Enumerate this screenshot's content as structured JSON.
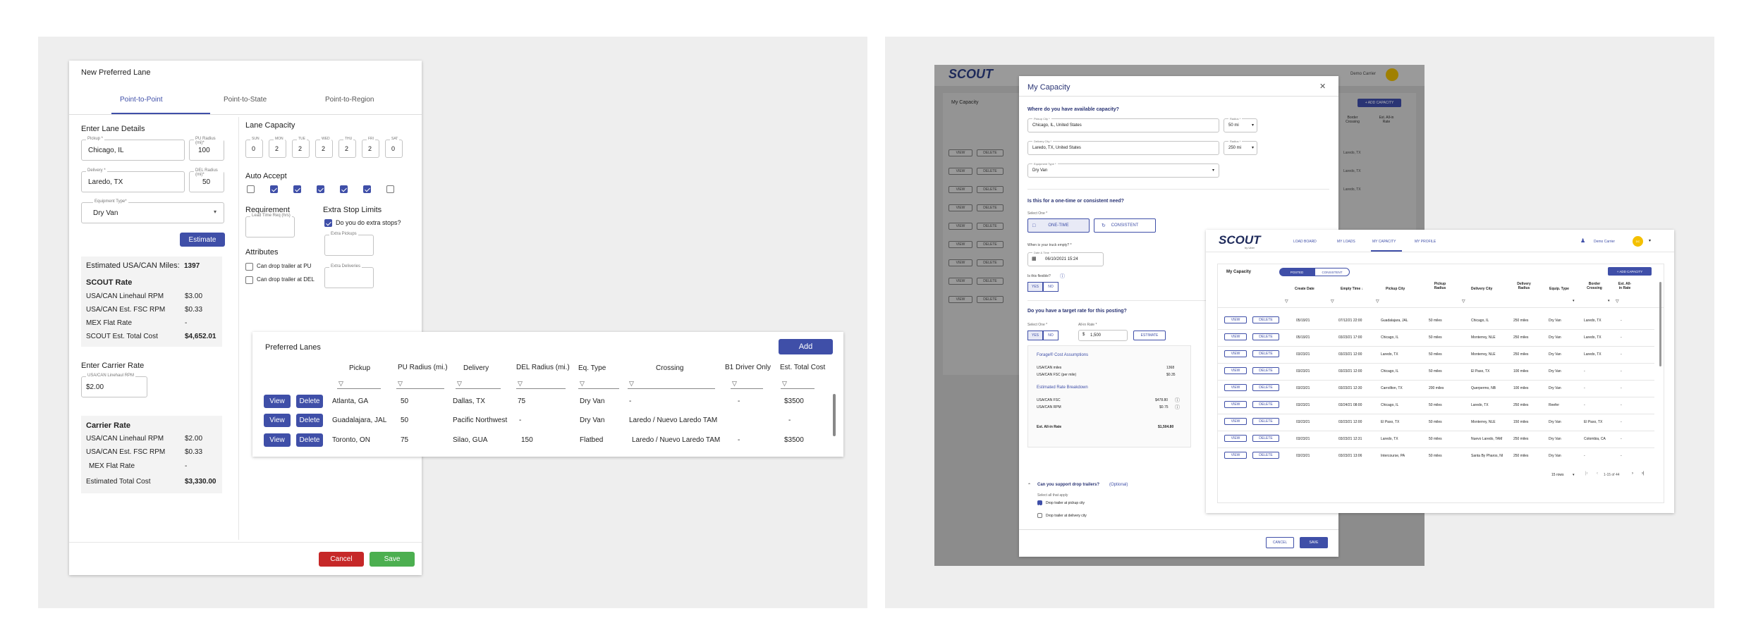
{
  "left": {
    "title": "New Preferred Lane",
    "tabs": [
      "Point-to-Point",
      "Point-to-State",
      "Point-to-Region"
    ],
    "enter_lane_details": "Enter Lane Details",
    "pickup_label": "Pickup *",
    "pickup_value": "Chicago, IL",
    "pu_radius_label": "PU Radius (mi)*",
    "pu_radius_value": "100",
    "delivery_label": "Delivery *",
    "delivery_value": "Laredo, TX",
    "del_radius_label": "DEL Radius (mi)*",
    "del_radius_value": "50",
    "equipment_label": "Equipment Type*",
    "equipment_value": "Dry Van",
    "estimate_btn": "Estimate",
    "lane_capacity": "Lane Capacity",
    "days": [
      {
        "label": "SUN",
        "value": "0",
        "auto": false
      },
      {
        "label": "MON",
        "value": "2",
        "auto": true
      },
      {
        "label": "TUE",
        "value": "2",
        "auto": true
      },
      {
        "label": "WED",
        "value": "2",
        "auto": true
      },
      {
        "label": "THU",
        "value": "2",
        "auto": true
      },
      {
        "label": "FRI",
        "value": "2",
        "auto": true
      },
      {
        "label": "SAT",
        "value": "0",
        "auto": false
      }
    ],
    "auto_accept": "Auto Accept",
    "requirement": "Requirement",
    "lead_time_label": "Lead Time Req (hrs)",
    "extra_stop_limits": "Extra Stop Limits",
    "extra_stops_q": "Do you do extra stops?",
    "extra_pickups_label": "Extra Pickups",
    "extra_deliveries_label": "Extra Deliveries",
    "attributes": "Attributes",
    "attr_pu": "Can drop trailer at PU",
    "attr_del": "Can drop trailer at DEL",
    "est_miles_label": "Estimated USA/CAN Miles:",
    "est_miles_value": "1397",
    "scout_rate": "SCOUT Rate",
    "scout_rows": [
      {
        "label": "USA/CAN Linehaul RPM",
        "value": "$3.00"
      },
      {
        "label": "USA/CAN Est. FSC RPM",
        "value": "$0.33"
      },
      {
        "label": "MEX Flat Rate",
        "value": "-"
      },
      {
        "label": "SCOUT Est. Total Cost",
        "value": "$4,652.01"
      }
    ],
    "enter_carrier_rate": "Enter Carrier Rate",
    "carrier_rpm_label": "USA/CAN Linehaul RPM",
    "carrier_rpm_value": "$2.00",
    "carrier_rate": "Carrier Rate",
    "carrier_rows": [
      {
        "label": "USA/CAN Linehaul RPM",
        "value": "$2.00"
      },
      {
        "label": "USA/CAN Est. FSC RPM",
        "value": "$0.33"
      },
      {
        "label": "MEX Flat Rate",
        "value": "-"
      },
      {
        "label": "Estimated Total Cost",
        "value": "$3,330.00"
      }
    ],
    "cancel_btn": "Cancel",
    "save_btn": "Save",
    "lanes": {
      "title": "Preferred Lanes",
      "add_btn": "Add",
      "headers": [
        "Pickup",
        "PU Radius (mi.)",
        "Delivery",
        "DEL Radius (mi.)",
        "Eq. Type",
        "Crossing",
        "B1 Driver Only",
        "Est. Total Cost"
      ],
      "view_btn": "View",
      "delete_btn": "Delete",
      "rows": [
        [
          "Atlanta, GA",
          "50",
          "Dallas, TX",
          "75",
          "Dry Van",
          "-",
          "-",
          "$3500"
        ],
        [
          "Guadalajara, JAL",
          "50",
          "Pacific Northwest",
          "-",
          "Dry Van",
          "Laredo / Nuevo Laredo TAM",
          "",
          "-"
        ],
        [
          "Toronto, ON",
          "75",
          "Silao, GUA",
          "150",
          "Flatbed",
          "Laredo / Nuevo Laredo TAM",
          "-",
          "$3500"
        ]
      ]
    }
  },
  "right": {
    "brand": "SCOUT",
    "brand_sub": "by Uber",
    "nav": [
      "LOAD BOARD",
      "MY LOADS",
      "MY CAPACITY",
      "MY PROFILE"
    ],
    "user": "Demo Carrier",
    "user_initials": "DC",
    "bg_my_capacity": "My Capacity",
    "bg_add": "+ ADD CAPACITY",
    "bg_headers": [
      "Border Crossing",
      "Est. All-in Rate"
    ],
    "bg_view": "VIEW",
    "bg_delete": "DELETE",
    "bg_rows": [
      "Laredo, TX",
      "Laredo, TX",
      "Laredo, TX",
      "-",
      "-",
      "-",
      "-",
      "-",
      "-"
    ],
    "modal": {
      "title": "My Capacity",
      "q1": "Where do you have available capacity?",
      "pickup_label": "Pickup City *",
      "pickup_value": "Chicago, IL, United States",
      "radius_label": "Radius *",
      "radius1": "50 mi",
      "delivery_label": "Delivery City *",
      "delivery_value": "Laredo, TX, United States",
      "radius2": "250 mi",
      "equip_label": "Equipment Type *",
      "equip_value": "Dry Van",
      "q2": "Is this for a one-time or consistent need?",
      "select_one": "Select One *",
      "one_time": "ONE-TIME",
      "consistent": "CONSISTENT",
      "q3": "When is your truck empty? *",
      "date_label": "Date & Time",
      "date_value": "06/10/2021 15:24",
      "q4": "Is this flexible?",
      "yes": "YES",
      "no": "NO",
      "q5": "Do you have a target rate for this posting?",
      "select_one2": "Select One *",
      "allin_label": "All-in Rate *",
      "allin_value": "1,500",
      "estimate": "ESTIMATE",
      "forage_title": "Forage® Cost Assumptions",
      "forage_rows": [
        {
          "label": "USA/CAN miles",
          "value": "1368"
        },
        {
          "label": "USA/CAN FSC (per mile)",
          "value": "$0.35"
        }
      ],
      "breakdown_title": "Estimated Rate Breakdown",
      "breakdown_rows": [
        {
          "label": "USA/CAN FSC",
          "value": "$478.80"
        },
        {
          "label": "USA/CAN RPM",
          "value": "$0.75"
        }
      ],
      "est_allin_label": "Est. All-in Rate",
      "est_allin_value": "$1,504.80",
      "drop_q": "Can you support drop trailers?",
      "optional": "(Optional)",
      "select_all": "Select all that apply",
      "drop_pickup": "Drop trailer at pickup city",
      "drop_delivery": "Drop trailer at delivery city",
      "cancel": "CANCEL",
      "save": "SAVE"
    },
    "front": {
      "title": "My Capacity",
      "toggle": [
        "POSTED",
        "CONSISTENT"
      ],
      "add": "+ ADD CAPACITY",
      "headers": [
        "Create Date",
        "Empty Time ↓",
        "Pickup City",
        "Pickup Radius",
        "Delivery City",
        "Delivery Radius",
        "Equip. Type",
        "Border Crossing",
        "Est. All-in Rate"
      ],
      "view": "VIEW",
      "delete": "DELETE",
      "rows": [
        [
          "05/19/21",
          "07/12/21 22:00",
          "Guadalajara, JAL",
          "50 miles",
          "Chicago, IL",
          "250 miles",
          "Dry Van",
          "Laredo, TX",
          "-"
        ],
        [
          "05/19/21",
          "03/23/21 17:00",
          "Chicago, IL",
          "50 miles",
          "Monterrey, NLE",
          "250 miles",
          "Dry Van",
          "Laredo, TX",
          "-"
        ],
        [
          "03/23/21",
          "03/23/21 12:00",
          "Laredo, TX",
          "50 miles",
          "Monterrey, NLE",
          "250 miles",
          "Dry Van",
          "Laredo, TX",
          "-"
        ],
        [
          "03/23/21",
          "03/23/21 12:00",
          "Chicago, IL",
          "50 miles",
          "El Paso, TX",
          "100 miles",
          "Dry Van",
          "-",
          "-"
        ],
        [
          "03/23/21",
          "03/23/21 12:30",
          "Carrollton, TX",
          "200 miles",
          "Querpermo, NB",
          "100 miles",
          "Dry Van",
          "-",
          "-"
        ],
        [
          "03/23/21",
          "03/24/21 08:00",
          "Chicago, IL",
          "50 miles",
          "Laredo, TX",
          "250 miles",
          "Reefer",
          "-",
          "-"
        ],
        [
          "03/23/21",
          "03/23/21 12:00",
          "El Paso, TX",
          "50 miles",
          "Monterrey, NLE",
          "150 miles",
          "Dry Van",
          "El Paso, TX",
          "-"
        ],
        [
          "03/23/21",
          "03/23/21 12:31",
          "Laredo, TX",
          "50 miles",
          "Nuevo Laredo, TAM",
          "250 miles",
          "Dry Van",
          "Colombia, CA",
          "-"
        ],
        [
          "03/23/21",
          "03/23/21 13:06",
          "Intercourse, PA",
          "50 miles",
          "Santa By Pharos, NI",
          "250 miles",
          "Dry Van",
          "-",
          "-"
        ]
      ],
      "pager_rows": "15 rows",
      "pager_range": "1-15 of 44"
    }
  },
  "colors": {
    "primary": "#3f4fa8",
    "red": "#c62828",
    "green": "#4caf50",
    "panel": "#eeeeee",
    "overlay": "#7a7a7a"
  }
}
